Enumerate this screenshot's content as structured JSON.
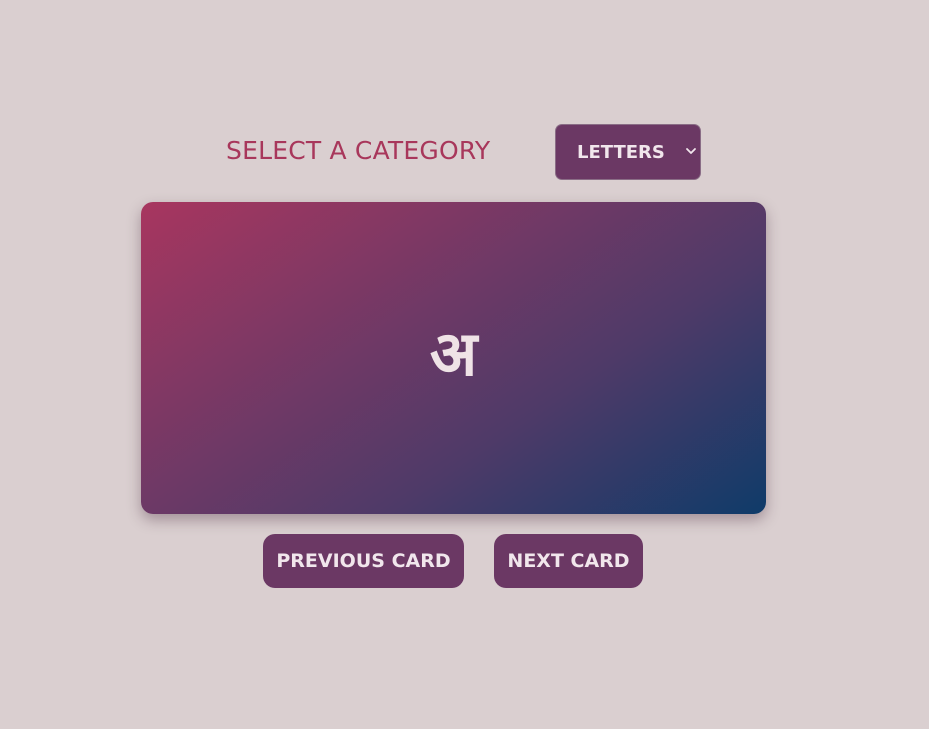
{
  "category": {
    "label": "SELECT A CATEGORY",
    "selected": "LETTERS"
  },
  "card": {
    "content": "अ"
  },
  "controls": {
    "previous_label": "PREVIOUS CARD",
    "next_label": "NEXT CARD"
  },
  "colors": {
    "background": "#dacfd0",
    "accent_text": "#a8375b",
    "button": "#6b3864",
    "card_gradient_start": "#a8365f",
    "card_gradient_end": "#0f3b69"
  }
}
